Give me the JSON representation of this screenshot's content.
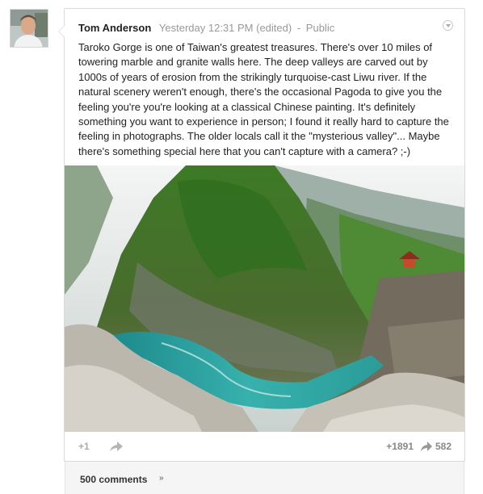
{
  "post": {
    "author": "Tom Anderson",
    "timestamp": "Yesterday 12:31 PM (edited)",
    "separator": "-",
    "visibility": "Public",
    "text": "Taroko Gorge is one of Taiwan's greatest treasures. There's over 10 miles of towering marble and granite walls here. The deep valleys are carved out by 1000s of years of erosion from the strikingly turquoise-cast Liwu river. If the natural scenery weren't enough, there's the occasional Pagoda to give you the feeling you're you're looking at a classical Chinese painting. It's definitely something you want to experience in person; I found it really hard to capture the feeling in photographs. The older locals call it the \"mysterious valley\"... Maybe there's something special here that you can't capture with a camera? ;-)"
  },
  "actions": {
    "plus_one_label": "+1",
    "plus_count": "+1891",
    "share_count": "582"
  },
  "comments": {
    "label": "500 comments",
    "chevron": "»"
  },
  "icons": {
    "avatar": "avatar",
    "menu": "chevron-down-icon",
    "share": "share-arrow-icon"
  },
  "colors": {
    "meta_text": "#999999",
    "action_text": "#888888",
    "river": "#2fa7a3",
    "foliage": "#3f7a2a"
  }
}
